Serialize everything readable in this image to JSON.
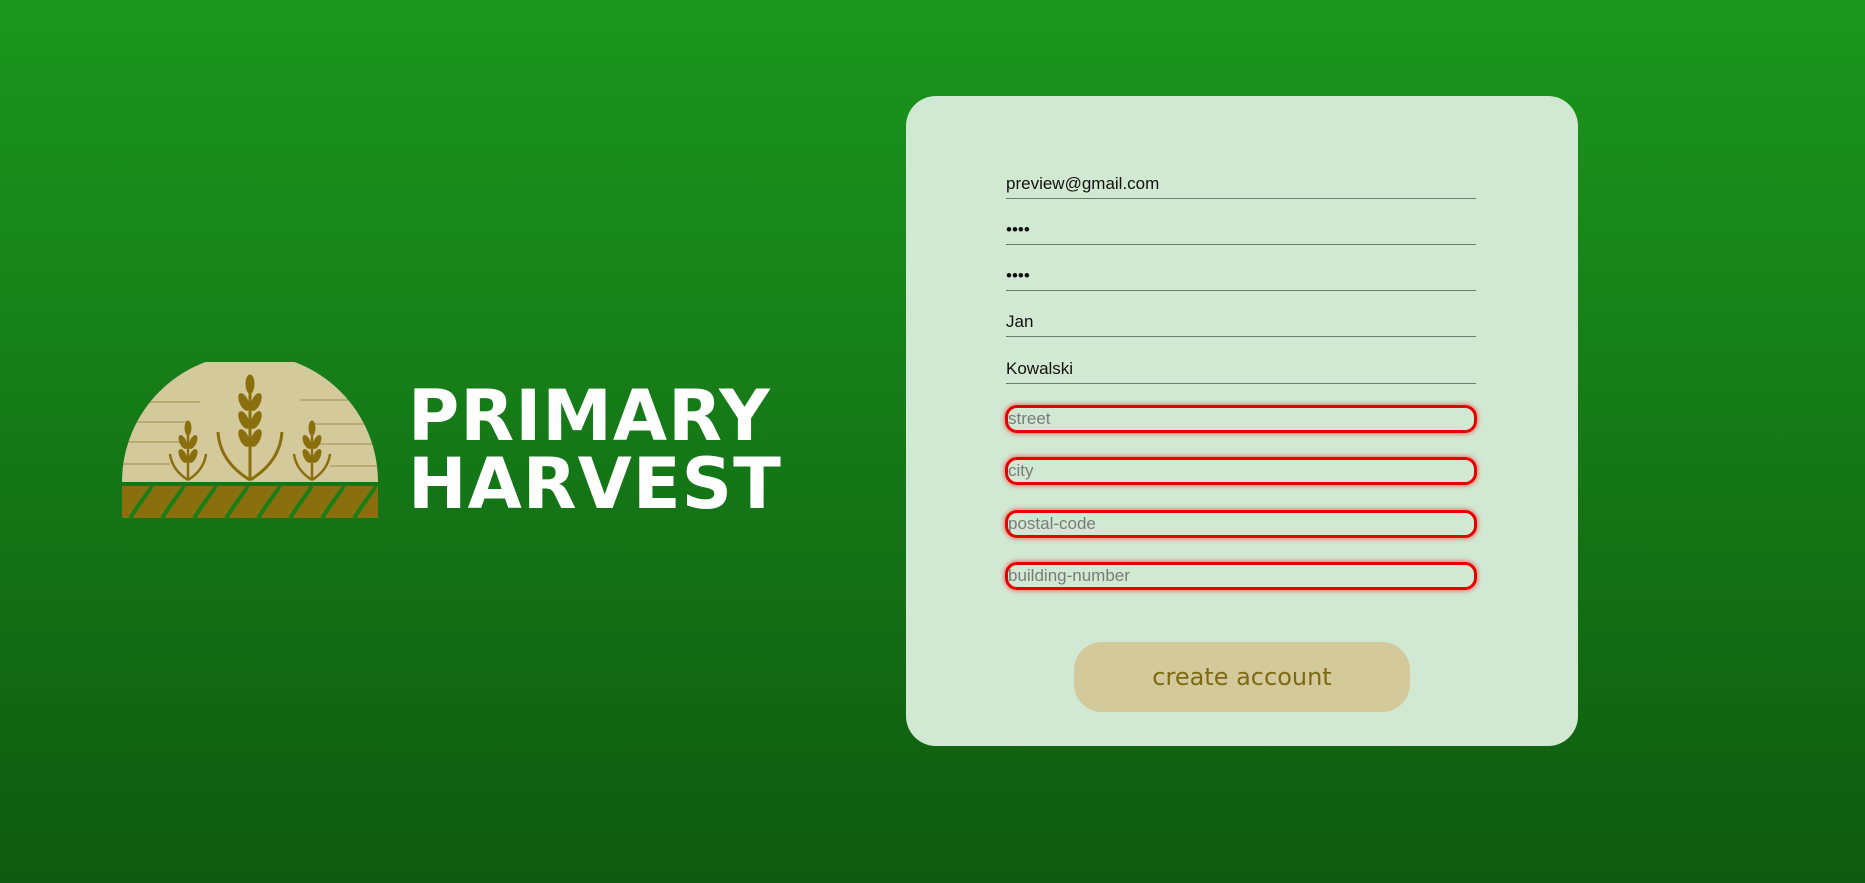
{
  "brand": {
    "line1": "PRIMARY",
    "line2": "HARVEST",
    "colors": {
      "sun": "#d3c99a",
      "wheat": "#8a6f0e",
      "field": "#8a6f0e",
      "text": "#ffffff"
    }
  },
  "form": {
    "email": {
      "value": "preview@gmail.com"
    },
    "password": {
      "value": "1234"
    },
    "password_confirm": {
      "value": "1234"
    },
    "first_name": {
      "value": "Jan"
    },
    "last_name": {
      "value": "Kowalski"
    },
    "street": {
      "placeholder": "street"
    },
    "city": {
      "placeholder": "city"
    },
    "postal_code": {
      "placeholder": "postal-code"
    },
    "building_number": {
      "placeholder": "building-number"
    },
    "submit_label": "create account"
  },
  "colors": {
    "card_bg": "#d1e8d2",
    "invalid_border": "#e60000",
    "button_bg": "#d3c99a",
    "button_text": "#7e6a12"
  }
}
